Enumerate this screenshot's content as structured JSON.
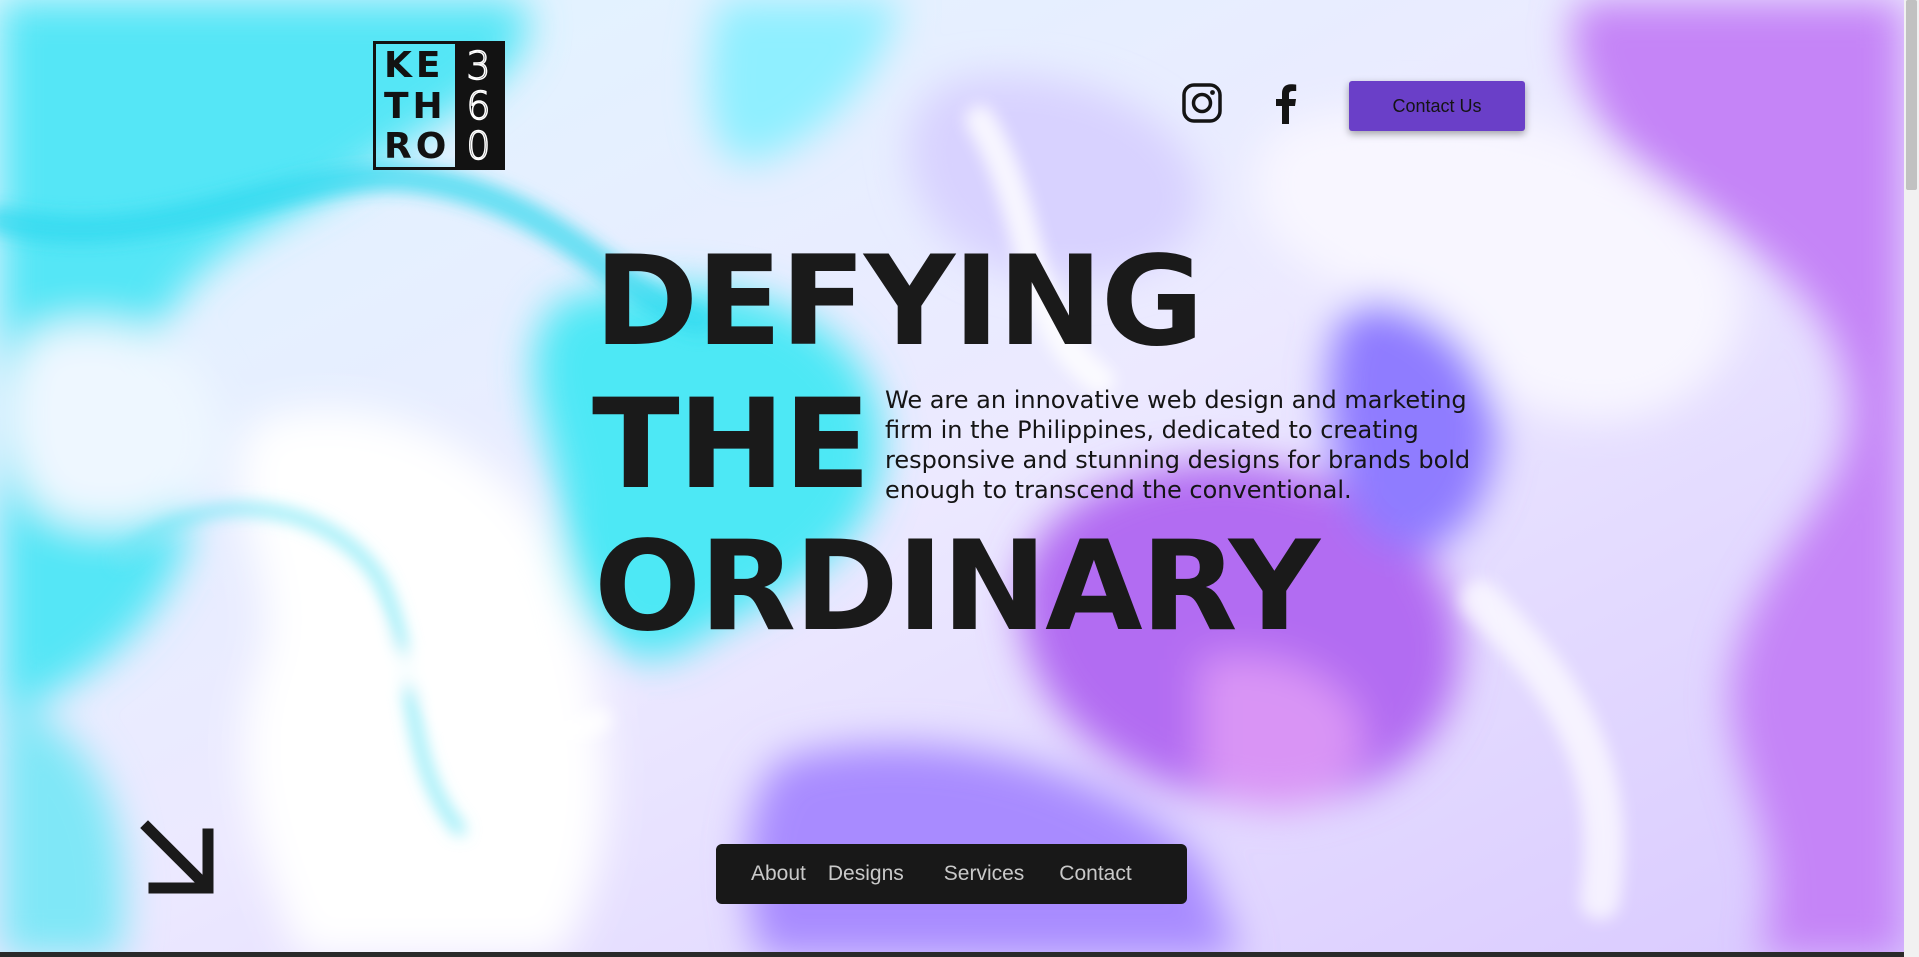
{
  "brand": {
    "logo_left_rows": [
      "KE",
      "TH",
      "RO"
    ],
    "logo_right_digits": [
      "3",
      "6",
      "0"
    ]
  },
  "header": {
    "social_icons": [
      "instagram-icon",
      "facebook-icon"
    ],
    "contact_button_label": "Contact Us"
  },
  "hero": {
    "headline_lines": [
      "DEFYING",
      "THE",
      "ORDINARY"
    ],
    "tagline": "We are an innovative web design and marketing firm in the Philippines, dedicated to creating responsive and stunning designs for brands bold enough to transcend the conventional."
  },
  "bottom_nav": {
    "items": [
      {
        "label": "About"
      },
      {
        "label": "Designs"
      },
      {
        "label": "Services"
      },
      {
        "label": "Contact"
      }
    ]
  },
  "decor": {
    "arrow_icon": "arrow-down-right-icon"
  },
  "colors": {
    "accent_button": "#6a3fc8",
    "text_dark": "#1a1a1a",
    "nav_bg": "#181818",
    "nav_text": "#c9c9c9",
    "swirl_cyan": "#4ee8f5",
    "swirl_purple": "#b56ff0",
    "swirl_lavender": "#cfc9ff"
  }
}
